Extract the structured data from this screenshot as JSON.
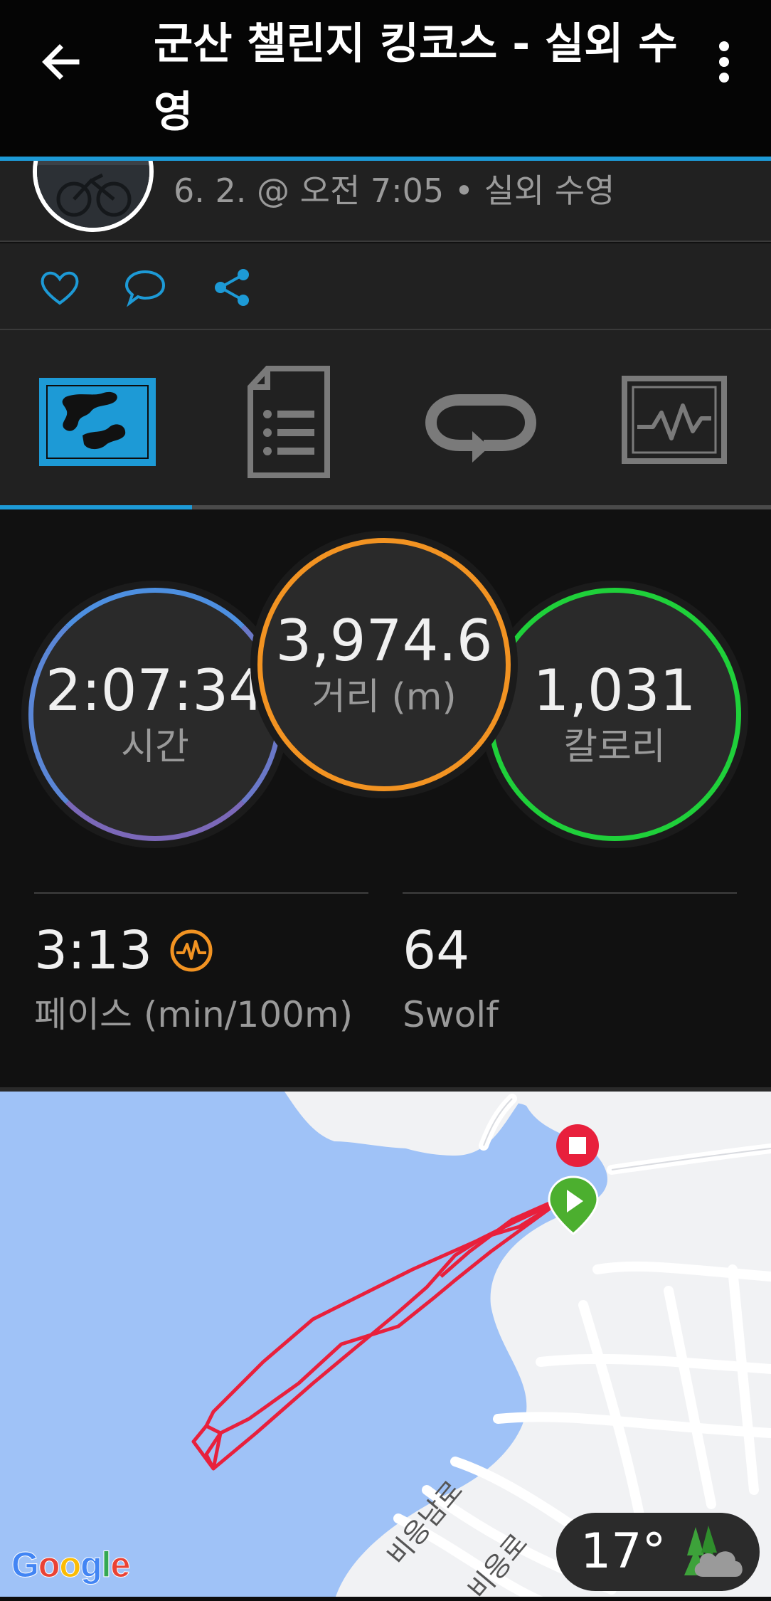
{
  "header": {
    "title": "군산 챌린지 킹코스 - 실외 수영",
    "back_icon": "arrow-left-icon",
    "menu_icon": "more-vert-icon"
  },
  "activity": {
    "date_line": "6. 2. @ 오전 7:05 • 실외 수영"
  },
  "actions": {
    "icons": [
      "heart-icon",
      "comment-icon",
      "share-icon"
    ]
  },
  "tabs": {
    "items": [
      "map-tab",
      "details-tab",
      "laps-tab",
      "charts-tab"
    ],
    "active_index": 0
  },
  "stats": {
    "time": {
      "value": "2:07:34",
      "label": "시간"
    },
    "distance": {
      "value": "3,974.6",
      "label": "거리 (m)"
    },
    "calories": {
      "value": "1,031",
      "label": "칼로리"
    },
    "pace": {
      "value": "3:13",
      "label": "페이스 (min/100m)"
    },
    "swolf": {
      "value": "64",
      "label": "Swolf"
    }
  },
  "map": {
    "roads": [
      "비응남로",
      "비응로"
    ],
    "provider": "Google",
    "weather_temp": "17°"
  },
  "colors": {
    "accent": "#1d9ad6",
    "time_ring": "#5a86d6",
    "distance_ring": "#f29322",
    "calories_ring": "#1fd03a",
    "route": "#e8203c",
    "water": "#9fc2f7",
    "land": "#f1f2f4"
  }
}
